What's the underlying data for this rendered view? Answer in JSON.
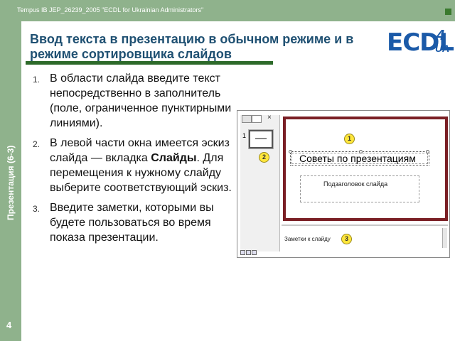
{
  "header": {
    "caption": "Tempus IB JEP_26239_2005 \"ECDL for Ukrainian Administrators\""
  },
  "sidebar": {
    "vertical_label": "Презентация (6-3)",
    "page_number": "4"
  },
  "title": "Ввод текста в презентацию в обычном режиме и в режиме сортировщика слайдов",
  "logo": {
    "main": "ECDL",
    "number": "4",
    "suffix": "UA"
  },
  "list": {
    "item1": {
      "num": "1.",
      "text": "В области слайда введите текст непосредственно в заполнитель (поле, ограниченное пунктирными линиями)."
    },
    "item2": {
      "num": "2.",
      "pre": "В левой части окна имеется эскиз слайда — вкладка ",
      "bold": "Слайды",
      "post": ". Для перемещения к нужному слайду выберите соответствующий эскиз."
    },
    "item3": {
      "num": "3.",
      "text": "Введите заметки, которыми вы будете пользоваться во время показа презентации."
    }
  },
  "screenshot": {
    "tab_close": "×",
    "thumb_number": "1",
    "title_placeholder": "Советы по презентациям",
    "subtitle_placeholder": "Подзаголовок слайда",
    "notes_placeholder": "Заметки к слайду",
    "badges": {
      "one": "1",
      "two": "2",
      "three": "3"
    }
  },
  "colors": {
    "green_bar": "#8fb28c",
    "title_blue": "#1f5072",
    "rule_green": "#2d6a2a",
    "logo_blue": "#1b5aa8",
    "slide_border": "#7a1f25",
    "badge_yellow": "#ffe63b"
  }
}
